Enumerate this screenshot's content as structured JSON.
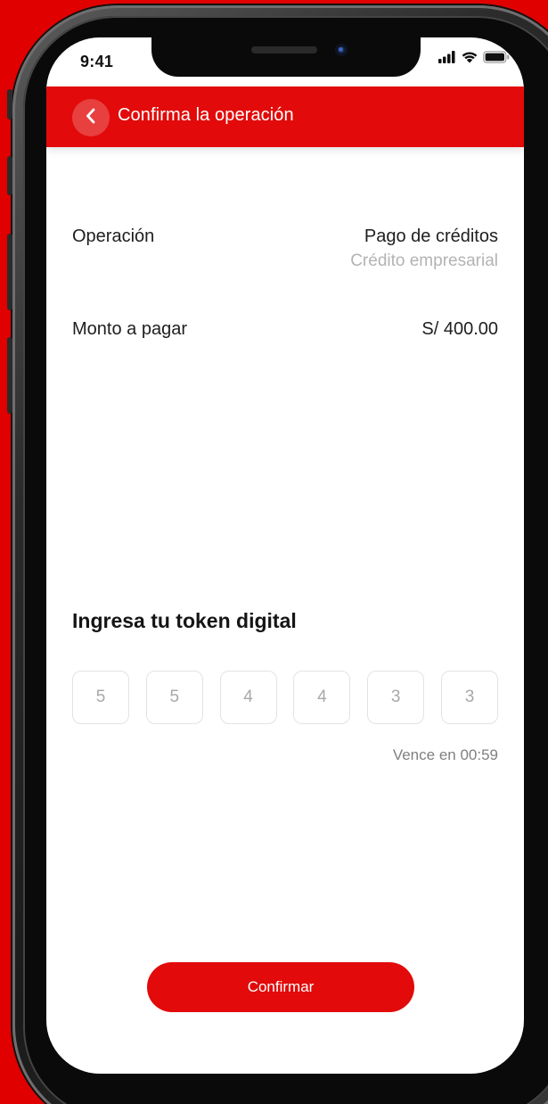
{
  "status_bar": {
    "time": "9:41",
    "icons": [
      "signal-icon",
      "wifi-icon",
      "battery-icon"
    ]
  },
  "header": {
    "back_icon": "chevron-left-icon",
    "title": "Confirma la operación",
    "color": "#e20a0a"
  },
  "details": {
    "operation_label": "Operación",
    "operation_value": "Pago de créditos",
    "operation_sub": "Crédito empresarial",
    "amount_label": "Monto a pagar",
    "amount_value": "S/ 400.00"
  },
  "token": {
    "title": "Ingresa tu token digital",
    "digits": [
      "5",
      "5",
      "4",
      "4",
      "3",
      "3"
    ],
    "expires_text": "Vence en 00:59"
  },
  "actions": {
    "confirm_label": "Confirmar"
  },
  "colors": {
    "brand_red": "#e20a0a",
    "background": "#e00000",
    "muted_text": "#b3b3b3"
  }
}
